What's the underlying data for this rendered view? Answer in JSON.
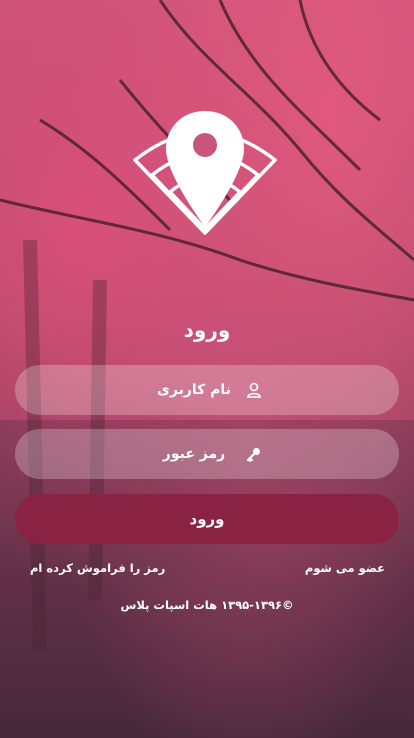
{
  "login": {
    "title": "ورود",
    "username_placeholder": "نام کاربری",
    "password_placeholder": "رمز عبور",
    "submit_label": "ورود",
    "register_link": "عضو می شوم",
    "forgot_link": "رمز را فراموش کرده ام",
    "copyright": "©۱۳۹۵-۱۳۹۶ هات اسپات پلاس"
  },
  "icons": {
    "logo": "location-wifi-logo",
    "username": "user-icon",
    "password": "key-icon"
  },
  "colors": {
    "button": "#8a2244",
    "field_background": "rgba(255,255,255,0.25)",
    "text": "#ffffff"
  }
}
